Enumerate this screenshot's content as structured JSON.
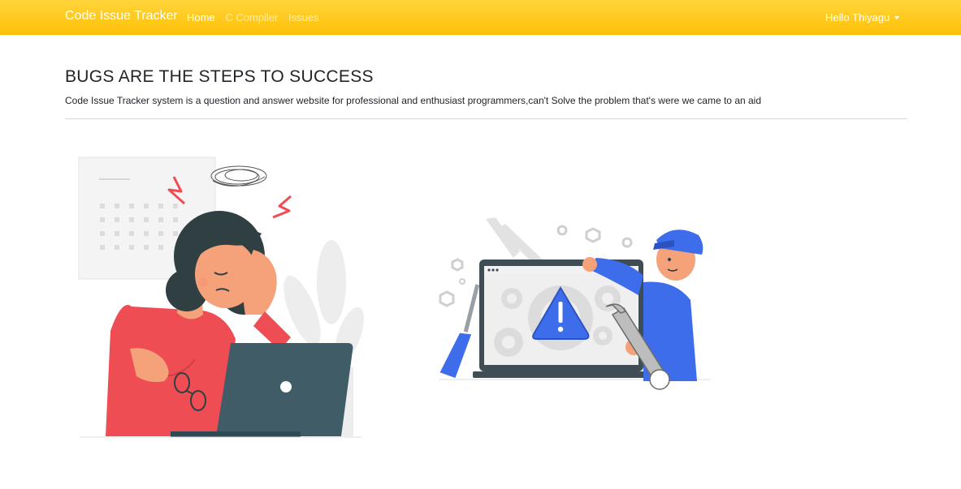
{
  "navbar": {
    "brand": "Code Issue Tracker",
    "links": [
      "Home",
      "C Compiler",
      "Issues"
    ],
    "user_greeting": "Hello Thiyagu",
    "color": "#ffc107"
  },
  "hero": {
    "title": "BUGS ARE THE STEPS TO SUCCESS",
    "subtitle": "Code Issue Tracker system is a question and answer website for professional and enthusiast programmers,can't Solve the problem that's were we came to an aid"
  },
  "illustrations": {
    "left": "frustrated-programmer-illustration",
    "right": "technician-fixing-computer-illustration"
  }
}
